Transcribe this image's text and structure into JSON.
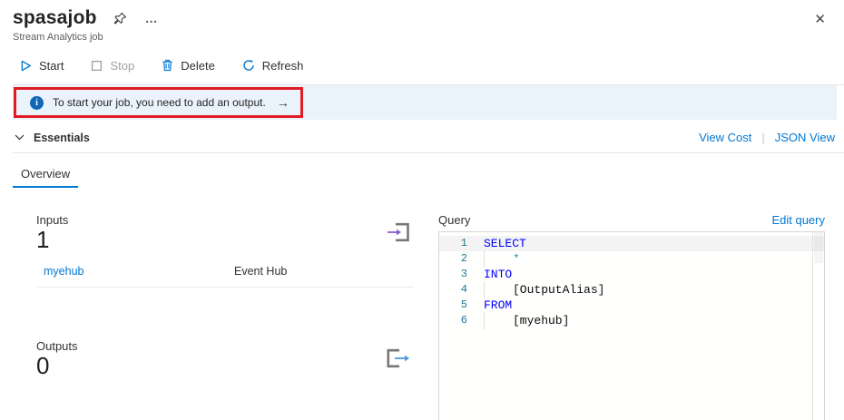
{
  "header": {
    "title": "spasajob",
    "subtitle": "Stream Analytics job",
    "more_glyph": "…",
    "close_glyph": "✕"
  },
  "toolbar": {
    "start_label": "Start",
    "stop_label": "Stop",
    "delete_label": "Delete",
    "refresh_label": "Refresh",
    "stop_disabled": true
  },
  "banner": {
    "info_glyph": "i",
    "message": "To start your job, you need to add an output.",
    "arrow_glyph": "→"
  },
  "essentials": {
    "label": "Essentials",
    "view_cost_label": "View Cost",
    "separator": "|",
    "json_view_label": "JSON View"
  },
  "tabs": {
    "overview_label": "Overview"
  },
  "inputs": {
    "label": "Inputs",
    "count": "1",
    "rows": [
      {
        "name": "myehub",
        "type": "Event Hub"
      }
    ]
  },
  "outputs": {
    "label": "Outputs",
    "count": "0"
  },
  "query": {
    "label": "Query",
    "edit_link_label": "Edit query",
    "lines": [
      {
        "number": "1",
        "text": "SELECT",
        "token_type": "keyword",
        "indented": false,
        "current": true
      },
      {
        "number": "2",
        "text": "*",
        "token_type": "operator",
        "indented": true,
        "current": false
      },
      {
        "number": "3",
        "text": "INTO",
        "token_type": "keyword",
        "indented": false,
        "current": false
      },
      {
        "number": "4",
        "text": "[OutputAlias]",
        "token_type": "identifier",
        "indented": true,
        "current": false
      },
      {
        "number": "5",
        "text": "FROM",
        "token_type": "keyword",
        "indented": false,
        "current": false
      },
      {
        "number": "6",
        "text": "[myehub]",
        "token_type": "identifier",
        "indented": true,
        "current": false
      }
    ]
  },
  "colors": {
    "accent": "#0078d4",
    "banner_background": "#eaf3fc",
    "annotation_red": "#e01b24",
    "keyword": "#0000ff",
    "operator": "#2b91af",
    "identifier": "#0a0a0a",
    "line_number": "#237893",
    "disabled_gray": "#a19f9d",
    "input_arrow_purple": "#8661c5",
    "output_arrow_blue": "#4a97e0",
    "icon_bracket_gray": "#797775"
  }
}
